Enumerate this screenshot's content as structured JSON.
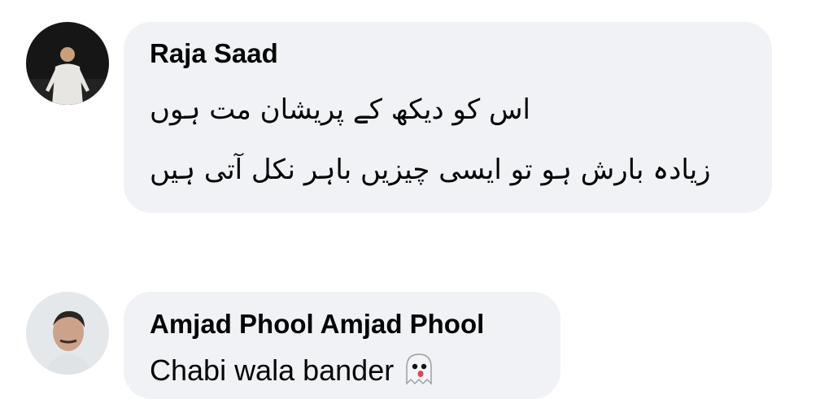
{
  "comments": [
    {
      "author": "Raja Saad",
      "lines": [
        "اس کو دیکھ کے پریشان مت ہوں",
        "زیادہ بارش ہو تو ایسی چیزیں باہر نکل آتی ہیں"
      ],
      "avatar_icon": "avatar-photo-man-night"
    },
    {
      "author": "Amjad Phool Amjad Phool",
      "text": "Chabi wala bander",
      "emoji_icon": "ghost-icon",
      "avatar_icon": "avatar-photo-man-portrait"
    }
  ],
  "colors": {
    "bubble": "#f0f2f5",
    "text": "#050505"
  }
}
